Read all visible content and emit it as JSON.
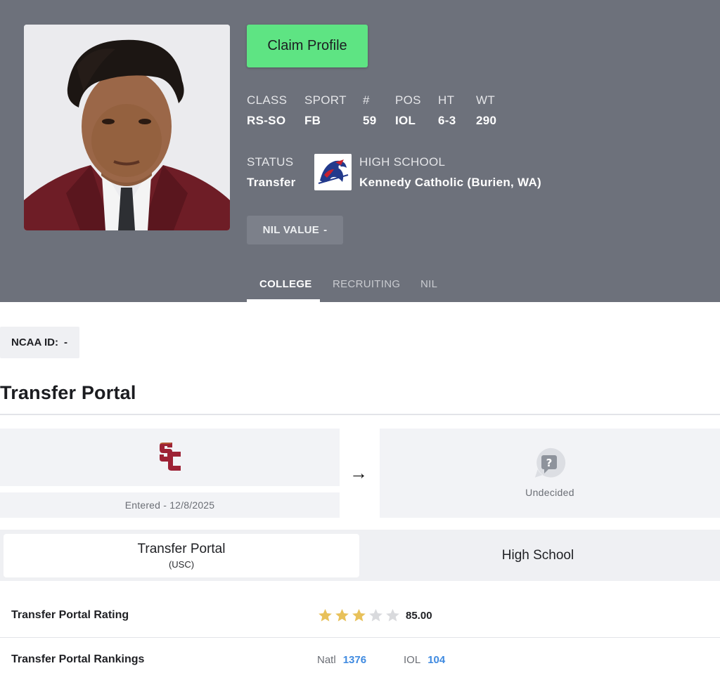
{
  "header": {
    "claim_label": "Claim Profile",
    "stats": [
      {
        "label": "CLASS",
        "value": "RS-SO"
      },
      {
        "label": "SPORT",
        "value": "FB"
      },
      {
        "label": "#",
        "value": "59"
      },
      {
        "label": "POS",
        "value": "IOL"
      },
      {
        "label": "HT",
        "value": "6-3"
      },
      {
        "label": "WT",
        "value": "290"
      }
    ],
    "status_label": "STATUS",
    "status_value": "Transfer",
    "high_school_label": "HIGH SCHOOL",
    "high_school_value": "Kennedy Catholic (Burien, WA)",
    "nil_label": "NIL VALUE",
    "nil_value": "-",
    "tabs": [
      "COLLEGE",
      "RECRUITING",
      "NIL"
    ],
    "active_tab": "COLLEGE"
  },
  "ncaa": {
    "label": "NCAA ID:",
    "value": "-"
  },
  "transfer_portal": {
    "title": "Transfer Portal",
    "from_logo": "usc-sc-logo",
    "entered": "Entered - 12/8/2025",
    "arrow": "→",
    "to_icon": "question-mark-icon",
    "to_label": "Undecided"
  },
  "switcher": {
    "active_main": "Transfer Portal",
    "active_sub": "(USC)",
    "inactive_main": "High School"
  },
  "rating": {
    "label": "Transfer Portal Rating",
    "stars_filled": 3,
    "stars_total": 5,
    "value": "85.00"
  },
  "rankings": {
    "label": "Transfer Portal Rankings",
    "natl_label": "Natl",
    "natl_value": "1376",
    "pos_label": "IOL",
    "pos_value": "104"
  },
  "colors": {
    "header_bg": "#6d717b",
    "claim_bg": "#5ee483",
    "usc_cardinal": "#9d2235",
    "usc_gold": "#d9a531",
    "star_filled": "#e8c15a",
    "star_empty": "#d9dadd",
    "link_blue": "#3f8ae0"
  }
}
